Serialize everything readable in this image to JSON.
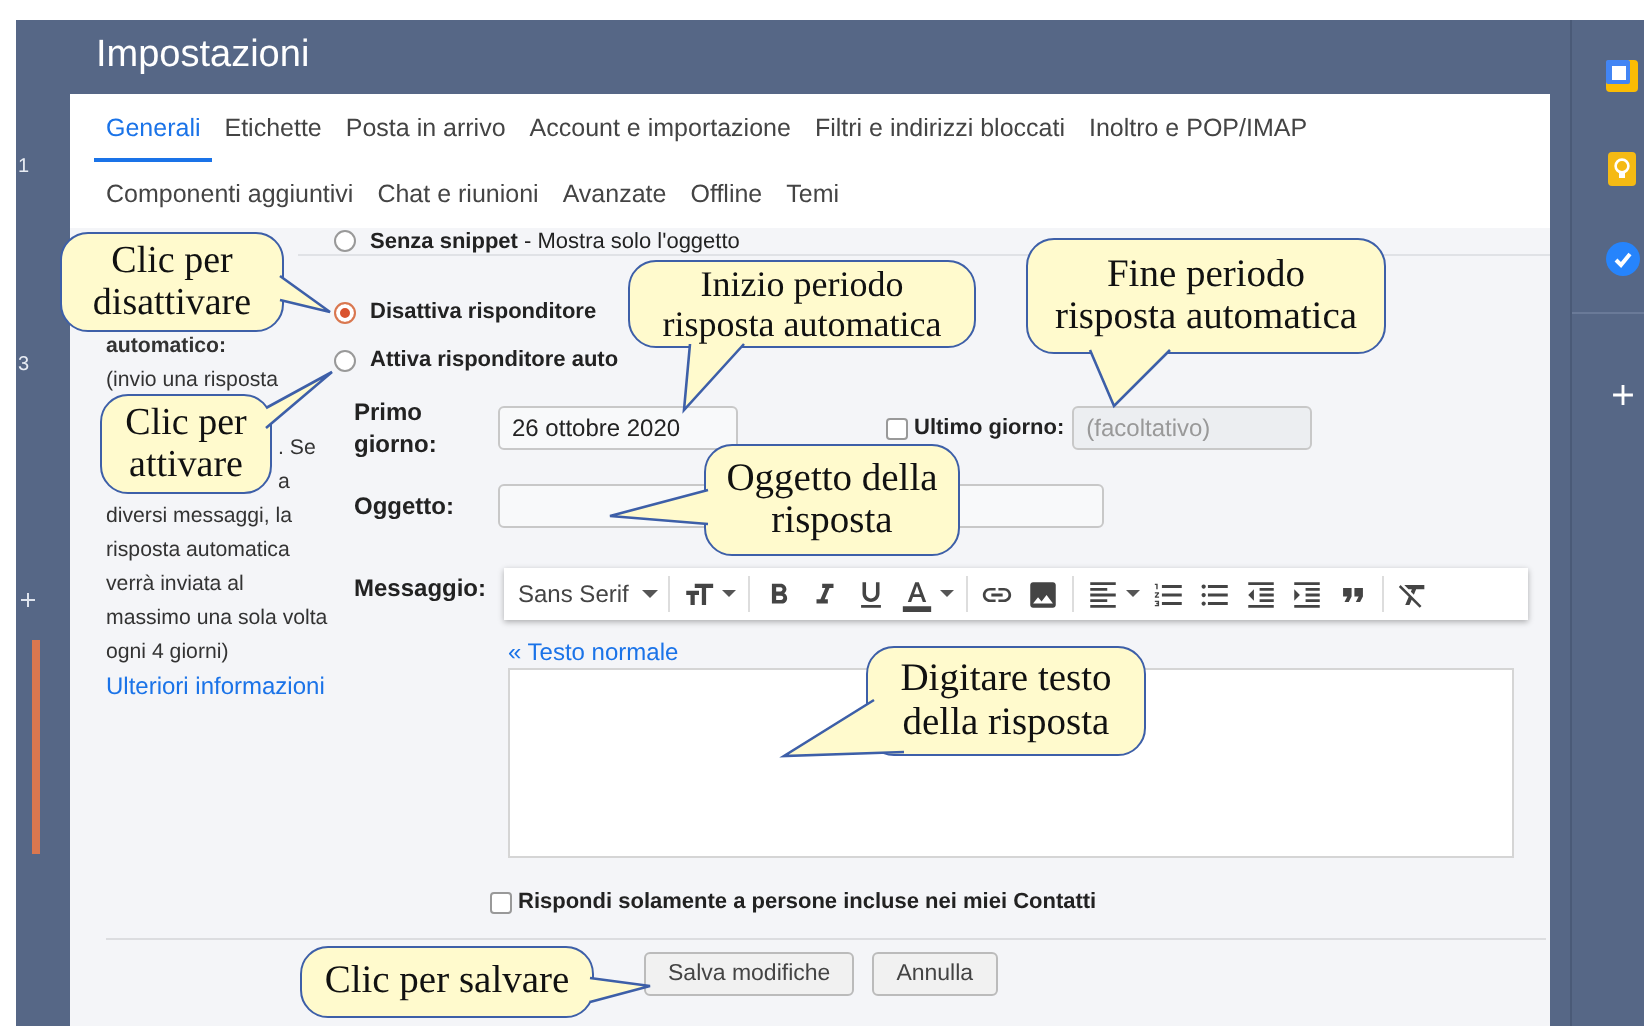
{
  "left_strip": {
    "labels": [
      "1",
      "3"
    ]
  },
  "header": {
    "title": "Impostazioni"
  },
  "tabs_row_1": [
    {
      "label": "Generali",
      "selected": true
    },
    {
      "label": "Etichette",
      "selected": false
    },
    {
      "label": "Posta in arrivo",
      "selected": false
    },
    {
      "label": "Account e importazione",
      "selected": false
    },
    {
      "label": "Filtri e indirizzi bloccati",
      "selected": false
    },
    {
      "label": "Inoltro e POP/IMAP",
      "selected": false
    }
  ],
  "tabs_row_2": [
    {
      "label": "Componenti aggiuntivi",
      "selected": false
    },
    {
      "label": "Chat e riunioni",
      "selected": false
    },
    {
      "label": "Avanzate",
      "selected": false
    },
    {
      "label": "Offline",
      "selected": false
    },
    {
      "label": "Temi",
      "selected": false
    }
  ],
  "snippet_option": {
    "label": "**Senza snippet** - Mostra solo l'oggetto",
    "selected": false
  },
  "responder": {
    "description": [
      {
        "text": "automatico:",
        "kind": "heading"
      },
      {
        "text": "(invio una risposta",
        "kind": "line"
      },
      {
        "text": ". Se",
        "kind": "fragment"
      },
      {
        "text": "a",
        "kind": "fragment"
      },
      {
        "text": "diversi messaggi, la",
        "kind": "line"
      },
      {
        "text": "risposta automatica",
        "kind": "line"
      },
      {
        "text": "verrà inviata al",
        "kind": "line"
      },
      {
        "text": "massimo una sola volta",
        "kind": "line"
      },
      {
        "text": "ogni 4 giorni)",
        "kind": "line"
      }
    ],
    "link": "Ulteriori informazioni",
    "options": [
      {
        "label": "Disattiva risponditore",
        "selected": true
      },
      {
        "label": "Attiva risponditore auto",
        "selected": false
      }
    ],
    "first_day": {
      "label": "Primo giorno:",
      "value": "26 ottobre 2020"
    },
    "last_day": {
      "label": "Ultimo giorno:",
      "checked": false,
      "placeholder": "(facoltativo)"
    },
    "subject": {
      "label": "Oggetto:"
    },
    "message": {
      "label": "Messaggio:",
      "font": "Sans Serif",
      "plain_text_link": "« Testo normale"
    },
    "contacts_only": {
      "label": "Rispondi solamente a persone incluse nei miei Contatti",
      "checked": false
    }
  },
  "buttons": [
    {
      "label": "Salva modifiche"
    },
    {
      "label": "Annulla"
    }
  ],
  "callouts": [
    {
      "lines": [
        "Clic per",
        "disattivare"
      ]
    },
    {
      "lines": [
        "Clic per",
        "attivare"
      ]
    },
    {
      "lines": [
        "Inizio periodo",
        "risposta automatica"
      ]
    },
    {
      "lines": [
        "Fine periodo",
        "risposta automatica"
      ]
    },
    {
      "lines": [
        "Oggetto della",
        "risposta"
      ]
    },
    {
      "lines": [
        "Digitare testo",
        "della risposta"
      ]
    },
    {
      "lines": [
        "Clic per salvare"
      ]
    }
  ]
}
